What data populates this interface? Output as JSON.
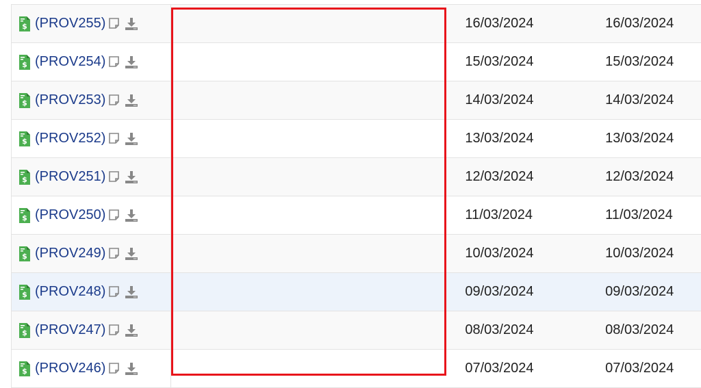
{
  "colors": {
    "link": "#1a3a8a",
    "icon_green": "#4caf50",
    "highlight_row": "#edf3fb",
    "annotation_red": "#e8141b"
  },
  "rows": [
    {
      "ref": "(PROV255)",
      "date1": "16/03/2024",
      "date2": "16/03/2024"
    },
    {
      "ref": "(PROV254)",
      "date1": "15/03/2024",
      "date2": "15/03/2024"
    },
    {
      "ref": "(PROV253)",
      "date1": "14/03/2024",
      "date2": "14/03/2024"
    },
    {
      "ref": "(PROV252)",
      "date1": "13/03/2024",
      "date2": "13/03/2024"
    },
    {
      "ref": "(PROV251)",
      "date1": "12/03/2024",
      "date2": "12/03/2024"
    },
    {
      "ref": "(PROV250)",
      "date1": "11/03/2024",
      "date2": "11/03/2024"
    },
    {
      "ref": "(PROV249)",
      "date1": "10/03/2024",
      "date2": "10/03/2024"
    },
    {
      "ref": "(PROV248)",
      "date1": "09/03/2024",
      "date2": "09/03/2024"
    },
    {
      "ref": "(PROV247)",
      "date1": "08/03/2024",
      "date2": "08/03/2024"
    },
    {
      "ref": "(PROV246)",
      "date1": "07/03/2024",
      "date2": "07/03/2024"
    }
  ],
  "highlighted_row_index": 7,
  "icons": {
    "document": "invoice-document-icon",
    "preview": "preview-icon",
    "download": "download-icon"
  }
}
